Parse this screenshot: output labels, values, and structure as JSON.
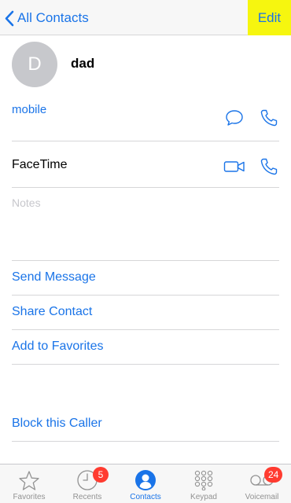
{
  "navbar": {
    "back_label": "All Contacts",
    "edit_label": "Edit"
  },
  "contact": {
    "initial": "D",
    "name": "dad"
  },
  "phone": {
    "label": "mobile"
  },
  "facetime": {
    "label": "FaceTime"
  },
  "notes": {
    "placeholder": "Notes"
  },
  "actions": {
    "send_message": "Send Message",
    "share_contact": "Share Contact",
    "add_favorites": "Add to Favorites",
    "block_caller": "Block this Caller"
  },
  "tabbar": {
    "tabs": [
      {
        "label": "Favorites",
        "icon": "star-icon"
      },
      {
        "label": "Recents",
        "icon": "clock-icon",
        "badge": "5"
      },
      {
        "label": "Contacts",
        "icon": "person-icon"
      },
      {
        "label": "Keypad",
        "icon": "keypad-icon"
      },
      {
        "label": "Voicemail",
        "icon": "voicemail-icon",
        "badge": "24"
      }
    ],
    "active": "Contacts"
  },
  "colors": {
    "accent": "#1a74e8",
    "edit_highlight": "#f6f60f",
    "badge": "#ff3b30",
    "avatar": "#c7c8cc"
  }
}
